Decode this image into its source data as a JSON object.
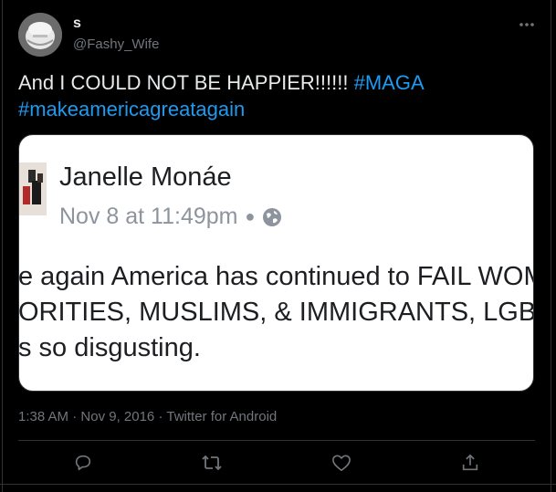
{
  "author": {
    "display_name": "s",
    "handle": "@Fashy_Wife",
    "avatar_icon": "avatar-image"
  },
  "tweet": {
    "text_plain": "And I COULD NOT BE HAPPIER!!!!!! ",
    "hashtag_1": "#MAGA",
    "hashtag_2": "#makeamericagreatagain"
  },
  "embedded_post": {
    "name": "Janelle Monáe",
    "date": "Nov 8 at 11:49pm",
    "visibility_icon": "globe-icon",
    "body_lines": [
      "e again America has continued to FAIL WOM",
      "ORITIES, MUSLIMS, & IMMIGRANTS, LGBTC",
      "s so disgusting."
    ]
  },
  "meta": {
    "time": "1:38 AM",
    "date": "Nov 9, 2016",
    "separator": "·",
    "source": "Twitter for Android"
  },
  "actions": [
    "reply-icon",
    "retweet-icon",
    "like-icon",
    "share-icon"
  ],
  "colors": {
    "background": "#000000",
    "text": "#e7e9ea",
    "muted": "#71767b",
    "link": "#1d9bf0",
    "border": "#2f3336"
  }
}
